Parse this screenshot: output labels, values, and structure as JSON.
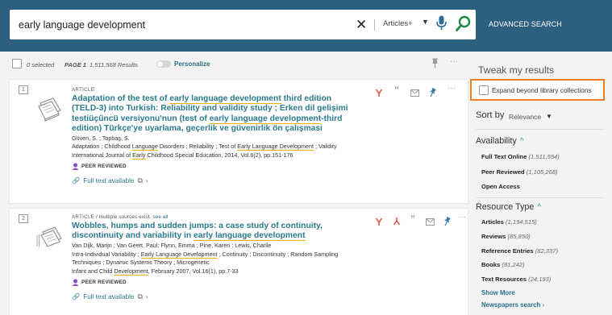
{
  "search": {
    "query": "early language development",
    "scope": "Articles+",
    "advanced_label": "ADVANCED SEARCH"
  },
  "results_header": {
    "selected": "0 selected",
    "page": "PAGE 1",
    "count": "1,511,568 Results",
    "personalize": "Personalize"
  },
  "results": [
    {
      "number": "1",
      "type": "ARTICLE",
      "title_parts": [
        "Adaptation of the test of ",
        "early language development",
        " third edition (TELD-3) into Turkish: Reliability and validity study ; Erken dil gelişimi testiüçüncü versiyonu'nun (test of ",
        "early language development",
        "-third edition) Türkçe'ye uyarlama, geçerlik ve güvenirlik ön çalışmasi"
      ],
      "authors": "Güven, S. ; Topbaş, S.",
      "subjects_parts": [
        "Adaptation ; Childhood ",
        "Language",
        " Disorders ; Reliability ; Test of ",
        "Early Language Development",
        " ; Validity"
      ],
      "source_parts": [
        "International Journal of ",
        "Early",
        " Childhood Special Education, 2014, Vol.6(2), pp.151-176"
      ],
      "peer": "PEER REVIEWED",
      "fulltext": "Full text available"
    },
    {
      "number": "2",
      "type": "ARTICLE",
      "type_suffix": " / multiple sources exist. ",
      "see_all": "see all",
      "title_parts": [
        "Wobbles, humps and sudden jumps: a case study of continuity, discontinuity and variability in ",
        "early language development"
      ],
      "authors": "Van Dijk, Marijn ; Van Geert, Paul; Flynn, Emma ; Pine, Karen ; Lewis, Charlie",
      "subjects_parts": [
        "Intra-Individual Variability ; ",
        "Early Language Development",
        " ; Continuity ; Discontinuity ; Random Sampling Techniques ; Dynamic Systems Theory ; Microgenetic"
      ],
      "source_parts": [
        "Infant and Child ",
        "Development",
        ", February 2007, Vol.16(1), pp.7-33"
      ],
      "peer": "PEER REVIEWED",
      "fulltext": "Full text available"
    }
  ],
  "sidebar": {
    "tweak": "Tweak my results",
    "expand": "Expand beyond library collections",
    "sort_label": "Sort by",
    "sort_value": "Relevance",
    "availability": {
      "title": "Availability",
      "items": [
        {
          "label": "Full Text Online",
          "count": "(1,511,554)"
        },
        {
          "label": "Peer Reviewed",
          "count": "(1,105,268)"
        },
        {
          "label": "Open Access",
          "count": ""
        }
      ]
    },
    "resource_type": {
      "title": "Resource Type",
      "items": [
        {
          "label": "Articles",
          "count": "(1,194,515)"
        },
        {
          "label": "Reviews",
          "count": "(85,850)"
        },
        {
          "label": "Reference Entries",
          "count": "(82,337)"
        },
        {
          "label": "Books",
          "count": "(81,242)"
        },
        {
          "label": "Text Resources",
          "count": "(24,193)"
        }
      ]
    },
    "show_more": "Show More",
    "newspapers": "Newspapers search"
  },
  "colors": {
    "header_bg": "#2d5f7e",
    "link": "#2a7a8e",
    "highlight_outline": "#ef7d22",
    "underline": "#f0b400",
    "citation_icon": "#e35a4a",
    "pin_icon": "#3a7fa3"
  }
}
